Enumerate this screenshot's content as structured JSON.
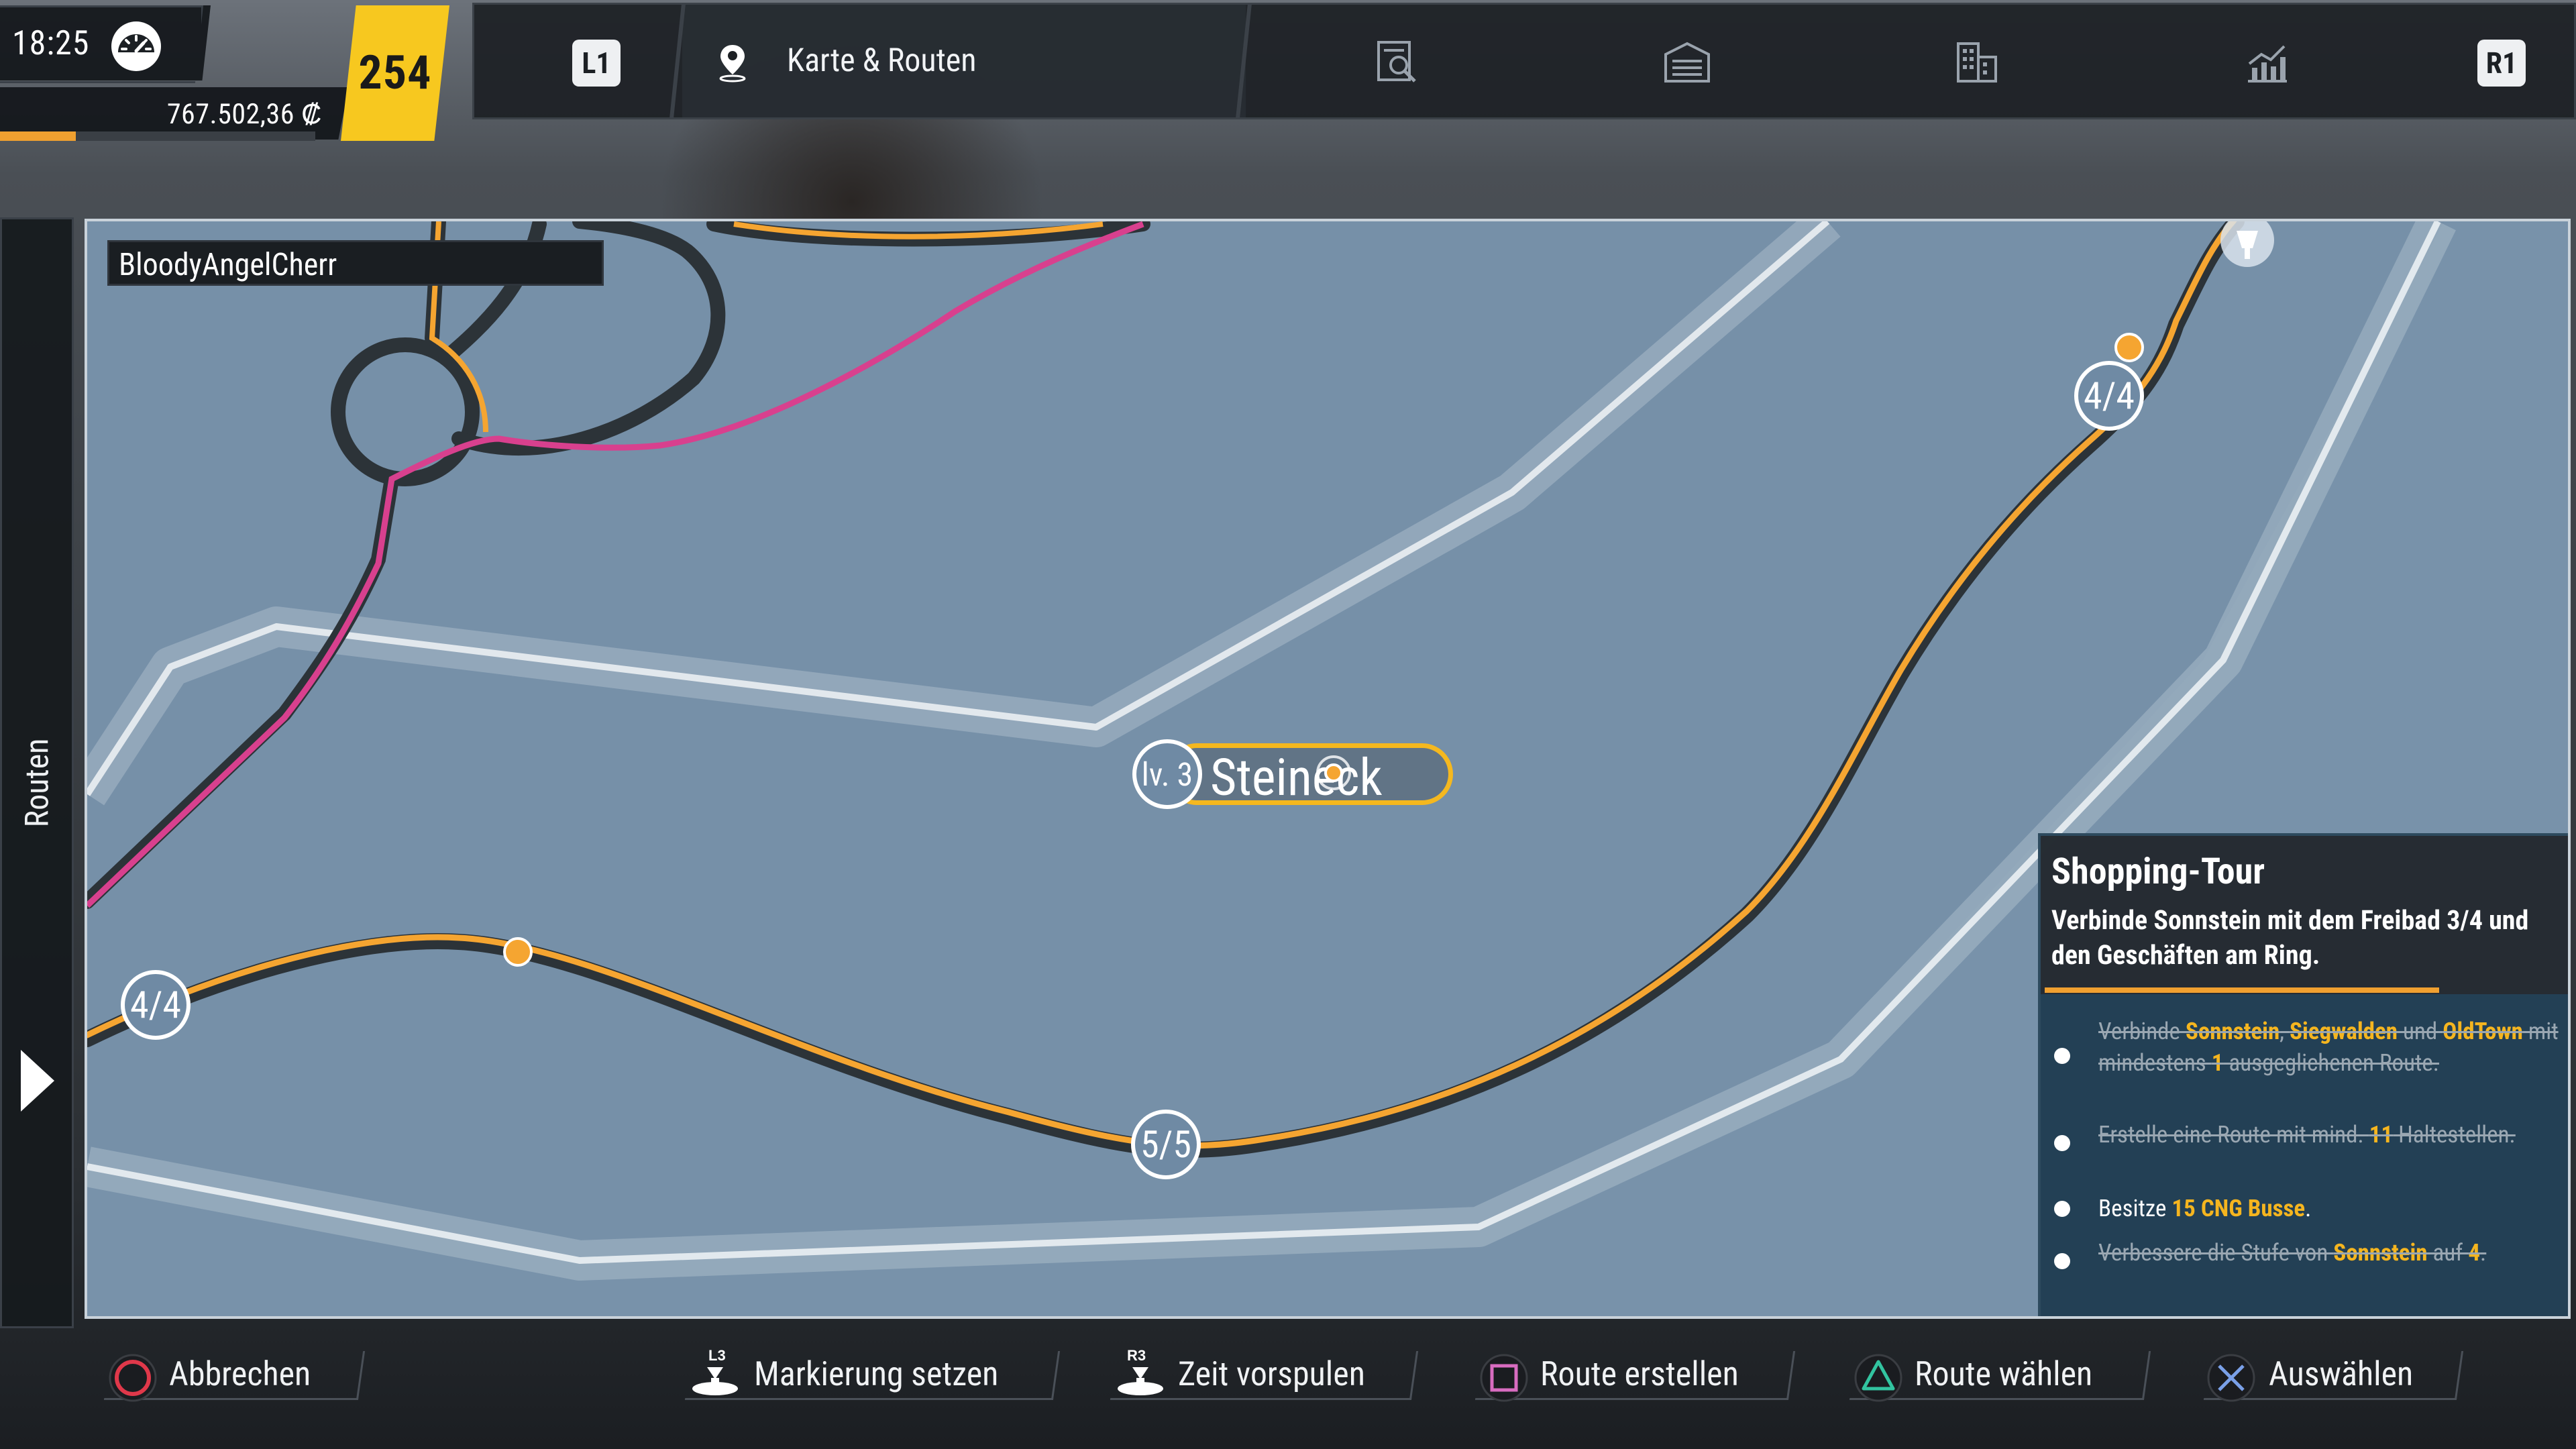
{
  "status": {
    "time": "18:25",
    "money": "767.502,36 ₡",
    "level": "254",
    "money_progress": 0.24
  },
  "nav": {
    "left_button": "L1",
    "right_button": "R1",
    "active_tab": "Karte & Routen",
    "tabs_icons": [
      "map-pin-icon",
      "finance-report-icon",
      "depot-icon",
      "city-buildings-icon",
      "statistics-chart-icon"
    ]
  },
  "sidebar": {
    "label": "Routen"
  },
  "map": {
    "player_name": "BloodyAngelCherr",
    "city": {
      "level": "lv. 3",
      "name": "Steineck"
    },
    "stops": [
      {
        "label": "4/4"
      },
      {
        "label": "5/5"
      },
      {
        "label": "4/4"
      }
    ],
    "colors": {
      "water": "#7690a8",
      "route_orange": "#f5a531",
      "route_pink": "#d8408e",
      "road": "#2c3338"
    }
  },
  "mission": {
    "title": "Shopping-Tour",
    "description": "Verbinde Sonnstein mit dem Freibad 3/4 und den Geschäften am Ring.",
    "tasks": [
      {
        "done": true,
        "parts": [
          "Verbinde ",
          "Sonnstein",
          ", ",
          "Siegwalden",
          " und ",
          "OldTown",
          " mit mindestens ",
          "1",
          " ausgeglichenen Route."
        ]
      },
      {
        "done": true,
        "parts": [
          "Erstelle eine Route mit mind. ",
          "11",
          " Haltestellen."
        ]
      },
      {
        "done": false,
        "parts": [
          "Besitze ",
          "15 CNG Busse",
          "."
        ]
      },
      {
        "done": true,
        "parts": [
          "Verbessere die Stufe von ",
          "Sonnstein",
          " auf ",
          "4",
          "."
        ]
      }
    ]
  },
  "prompts": {
    "cancel": "Abbrechen",
    "l3_tag": "L3",
    "marker": "Markierung setzen",
    "r3_tag": "R3",
    "fast_forward": "Zeit vorspulen",
    "create_route": "Route erstellen",
    "choose_route": "Route wählen",
    "select": "Auswählen"
  }
}
